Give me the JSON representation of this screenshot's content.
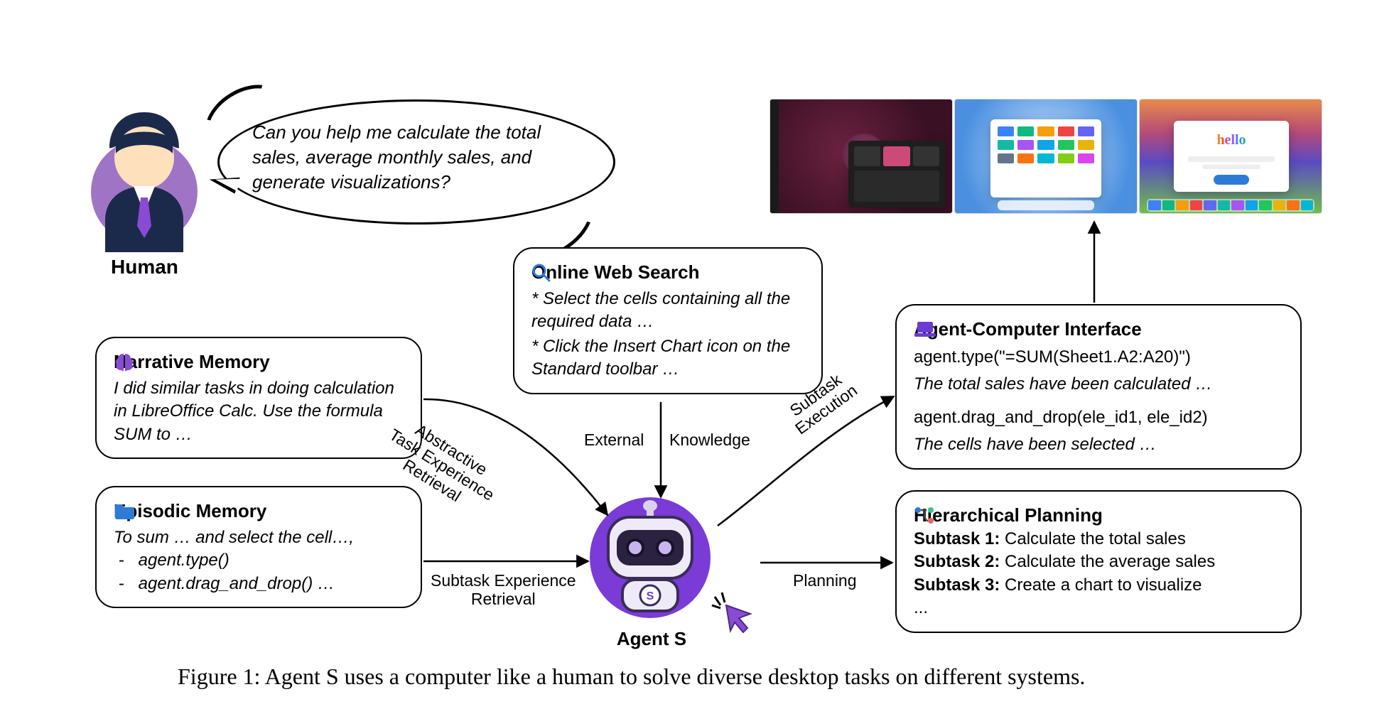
{
  "human_label": "Human",
  "agent_label": "Agent S",
  "speech": "Can you help me calculate the total sales, average monthly sales, and generate visualizations?",
  "narrative": {
    "title": "Narrative Memory",
    "body": "I did similar tasks in doing calculation in LibreOffice Calc. Use the formula SUM to …"
  },
  "episodic": {
    "title": "Episodic Memory",
    "intro": "To sum … and select the cell…,",
    "li1": "agent.type()",
    "li2": "agent.drag_and_drop() …"
  },
  "websearch": {
    "title": "Online Web Search",
    "l1": "* Select the cells containing all the required data …",
    "l2": "* Click the Insert Chart icon on the Standard toolbar …"
  },
  "aci": {
    "title": "Agent-Computer Interface",
    "c1": "agent.type(\"=SUM(Sheet1.A2:A20)\")",
    "r1": "The total sales have been calculated …",
    "c2": "agent.drag_and_drop(ele_id1, ele_id2)",
    "r2": "The cells have been selected …"
  },
  "hp": {
    "title": "Hierarchical Planning",
    "s1l": "Subtask 1:",
    "s1t": " Calculate the total sales",
    "s2l": "Subtask 2:",
    "s2t": " Calculate the average sales",
    "s3l": "Subtask 3:",
    "s3t": " Create a chart to visualize",
    "dots": "..."
  },
  "edge": {
    "abstractive_l1": "Abstractive",
    "abstractive_l2": "Task Experience",
    "abstractive_l3": "Retrieval",
    "external": "External",
    "knowledge": "Knowledge",
    "subtask_exec_l1": "Subtask",
    "subtask_exec_l2": "Execution",
    "subtask_exp_l1": "Subtask Experience",
    "subtask_exp_l2": "Retrieval",
    "planning": "Planning"
  },
  "caption": "Figure 1: Agent S uses a computer like a human to solve diverse desktop tasks on different systems."
}
